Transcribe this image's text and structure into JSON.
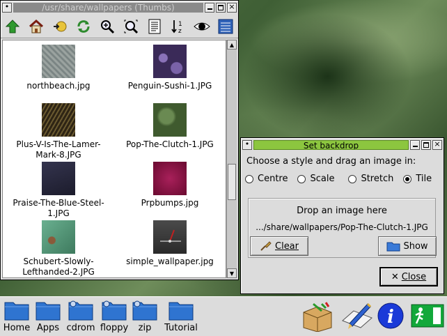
{
  "filer": {
    "title": "/usr/share/wallpapers (Thumbs)",
    "toolbar": [
      {
        "icon": "up-arrow-icon"
      },
      {
        "icon": "home-icon"
      },
      {
        "icon": "bookmarks-icon"
      },
      {
        "icon": "refresh-icon"
      },
      {
        "icon": "zoom-in-icon"
      },
      {
        "icon": "zoom-fit-icon"
      },
      {
        "icon": "details-icon"
      },
      {
        "icon": "sort-icon"
      },
      {
        "icon": "show-hidden-icon"
      },
      {
        "icon": "list-view-icon"
      }
    ],
    "files": [
      {
        "label": "northbeach.jpg",
        "color": "#8d9695"
      },
      {
        "label": "Penguin-Sushi-1.JPG",
        "color": "#4a3a68"
      },
      {
        "label": "Plus-V-Is-The-Lamer-Mark-8.JPG",
        "color": "#4a3a22"
      },
      {
        "label": "Pop-The-Clutch-1.JPG",
        "color": "#3f5a2e"
      },
      {
        "label": "Praise-The-Blue-Steel-1.JPG",
        "color": "#24243a"
      },
      {
        "label": "Prpbumps.jpg",
        "color": "#8a1040"
      },
      {
        "label": "Schubert-Slowly-Lefthanded-2.JPG",
        "color": "#4e8a70"
      },
      {
        "label": "simple_wallpaper.jpg",
        "color": "#3a3a3a"
      }
    ]
  },
  "backdrop": {
    "title": "Set backdrop",
    "prompt": "Choose a style and drag an image in:",
    "styles": [
      "Centre",
      "Scale",
      "Stretch",
      "Tile"
    ],
    "selected_style": "Tile",
    "drop_hint": "Drop an image here",
    "path": ".../share/wallpapers/Pop-The-Clutch-1.JPG",
    "clear_label": "Clear",
    "show_label": "Show",
    "close_label": "Close"
  },
  "panel": {
    "items": [
      "Home",
      "Apps",
      "cdrom",
      "floppy",
      "zip",
      "Tutorial"
    ]
  },
  "colors": {
    "title_active": "#8cc63f",
    "title_inactive": "#8a8a8a",
    "folder": "#2f74d0"
  }
}
